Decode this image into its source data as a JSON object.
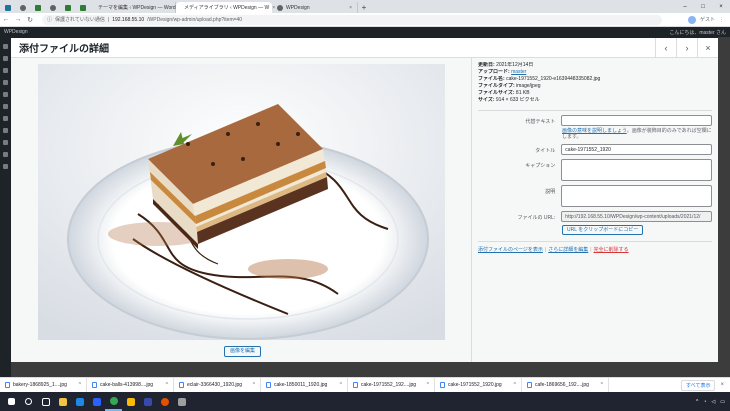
{
  "browser": {
    "tabs": [
      {
        "title": "テーマを編集 ‹ WPDesign — Word",
        "active": false
      },
      {
        "title": "メディアライブラリ ‹ WPDesign — W",
        "active": true
      },
      {
        "title": "WPDesign",
        "active": false
      }
    ],
    "new_tab": "+",
    "address": {
      "security": "保護されていない通信",
      "host": "192.168.55.10",
      "path": "/WPDesign/wp-admin/upload.php?item=40"
    },
    "toolbar_right_label": "ゲスト"
  },
  "wp": {
    "site_name": "WPDesign",
    "user_greeting": "こんにちは、master さん"
  },
  "modal": {
    "title": "添付ファイルの詳細",
    "edit_image_label": "画像を編集",
    "meta": {
      "uploaded_label": "更新日:",
      "uploaded_value": "2021年12月14日",
      "uploader_label": "アップロード:",
      "uploader_value": "master",
      "filename_label": "ファイル名:",
      "filename_value": "cake-1971552_1920-e1639448335082.jpg",
      "filetype_label": "ファイルタイプ:",
      "filetype_value": "image/jpeg",
      "filesize_label": "ファイルサイズ:",
      "filesize_value": "81 KB",
      "dimensions_label": "サイズ:",
      "dimensions_value": "914 × 633 ピクセル"
    },
    "fields": {
      "alt_label": "代替テキスト",
      "alt_value": "",
      "alt_help_link": "画像の意味を説明しましょう",
      "alt_help_text": "。画像が装飾目的のみであれば空欄にします。",
      "title_label": "タイトル",
      "title_value": "cake-1971552_1920",
      "caption_label": "キャプション",
      "caption_value": "",
      "description_label": "説明",
      "description_value": "",
      "url_label": "ファイルの URL:",
      "url_value": "http://192.168.55.10/WPDesign/wp-content/uploads/2021/12/",
      "copy_url_label": "URL をクリップボードにコピー"
    },
    "actions": {
      "view_page": "添付ファイルのページを表示",
      "edit_more": "さらに詳細を編集",
      "delete": "完全に削除する",
      "separator": "|"
    }
  },
  "downloads": {
    "items": [
      "bakery-1868925_1....jpg",
      "cake-balls-413998....jpg",
      "eclair-3366430_1920.jpg",
      "cake-1850011_1920.jpg",
      "cake-1971552_192....jpg",
      "cake-1971552_1920.jpg",
      "cafe-1869656_192....jpg"
    ],
    "show_all": "すべて表示"
  },
  "colors": {
    "accent": "#2271b1",
    "delete": "#d63638",
    "admin_bar": "#1d2327"
  }
}
